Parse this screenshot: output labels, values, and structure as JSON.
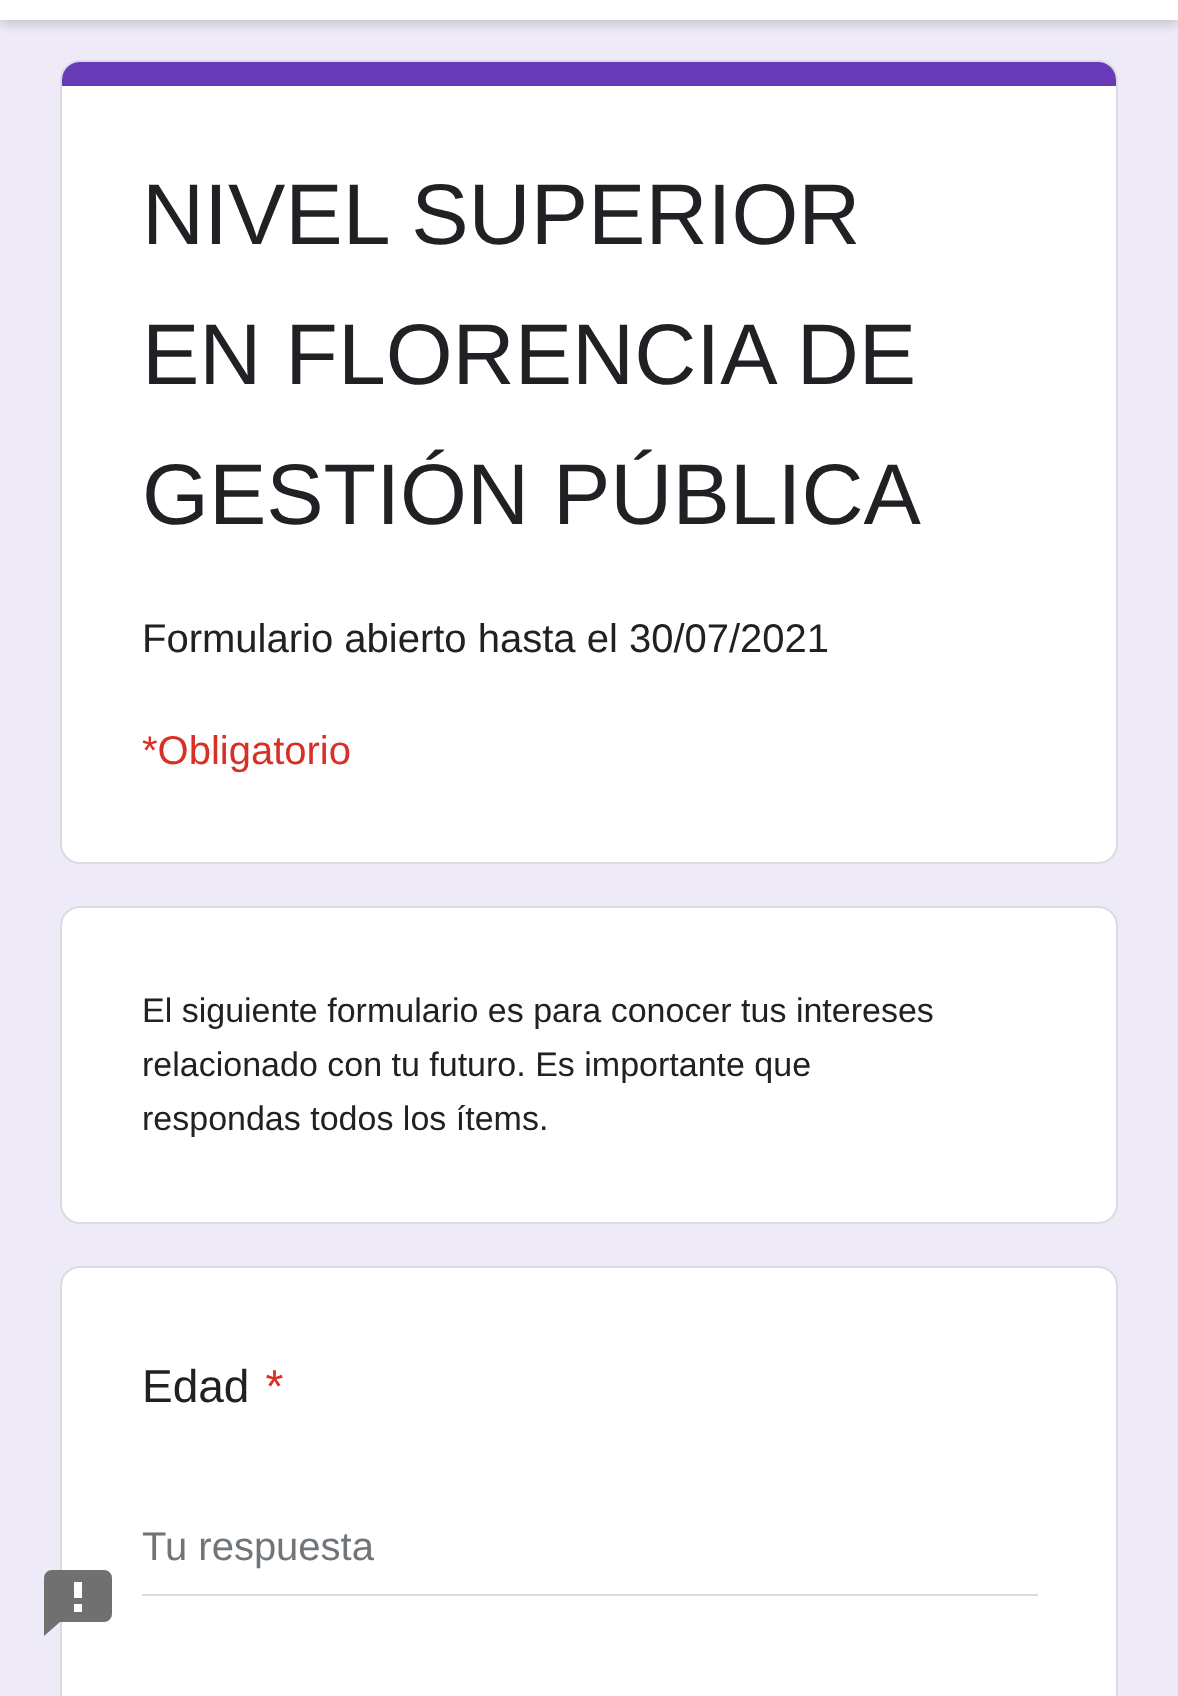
{
  "form": {
    "title": "NIVEL SUPERIOR EN FLORENCIA DE GESTIÓN PÚBLICA",
    "subtitle": "Formulario abierto hasta el 30/07/2021",
    "required_note": "*Obligatorio"
  },
  "description": "El siguiente formulario es para conocer tus intereses relacionado con tu futuro. Es importante que respondas todos los ítems.",
  "questions": [
    {
      "label": "Edad",
      "required_mark": "*",
      "placeholder": "Tu respuesta"
    }
  ]
}
